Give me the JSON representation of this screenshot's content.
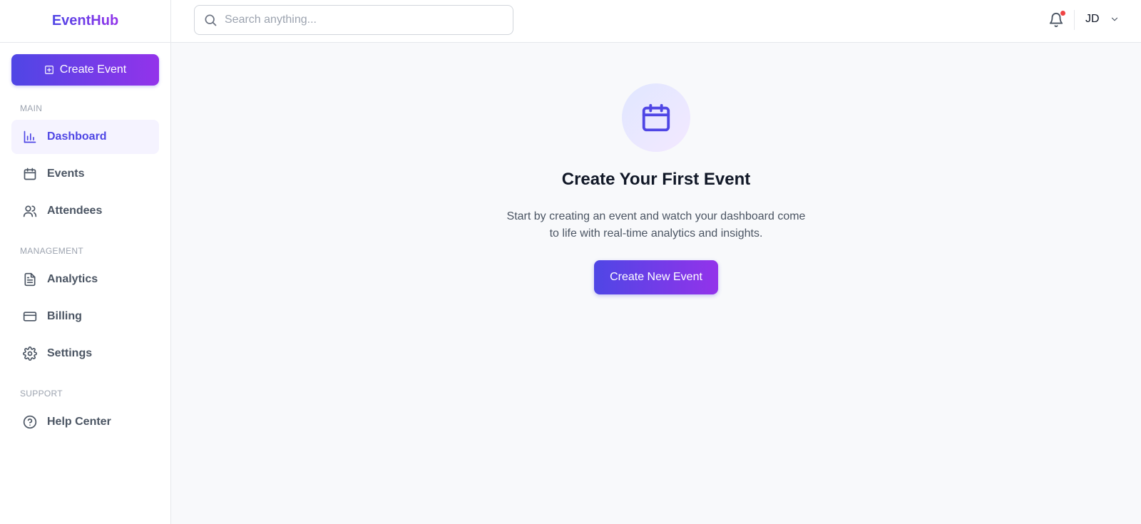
{
  "app": {
    "name": "EventHub"
  },
  "sidebar": {
    "create_button": {
      "label": "Create Event",
      "icon": "plus-square-icon"
    },
    "sections": [
      {
        "label": "MAIN",
        "items": [
          {
            "label": "Dashboard",
            "icon": "bar-chart-icon",
            "active": true
          },
          {
            "label": "Events",
            "icon": "calendar-icon",
            "active": false
          },
          {
            "label": "Attendees",
            "icon": "users-icon",
            "active": false
          }
        ]
      },
      {
        "label": "MANAGEMENT",
        "items": [
          {
            "label": "Analytics",
            "icon": "document-icon",
            "active": false
          },
          {
            "label": "Billing",
            "icon": "credit-card-icon",
            "active": false
          },
          {
            "label": "Settings",
            "icon": "gear-icon",
            "active": false
          }
        ]
      },
      {
        "label": "SUPPORT",
        "items": [
          {
            "label": "Help Center",
            "icon": "help-circle-icon",
            "active": false
          }
        ]
      }
    ]
  },
  "topbar": {
    "search": {
      "placeholder": "Search anything...",
      "value": ""
    },
    "notifications": {
      "icon": "bell-icon",
      "has_unread": true
    },
    "user": {
      "initials": "JD",
      "icon": "chevron-down-icon"
    }
  },
  "empty_state": {
    "icon": "calendar-icon",
    "title": "Create Your First Event",
    "description": "Start by creating an event and watch your dashboard come to life with real-time analytics and insights.",
    "button_label": "Create New Event"
  },
  "colors": {
    "accent_start": "#4f46e5",
    "accent_end": "#9333ea",
    "active_bg": "#f5f3ff",
    "notification_dot": "#ef4444"
  }
}
